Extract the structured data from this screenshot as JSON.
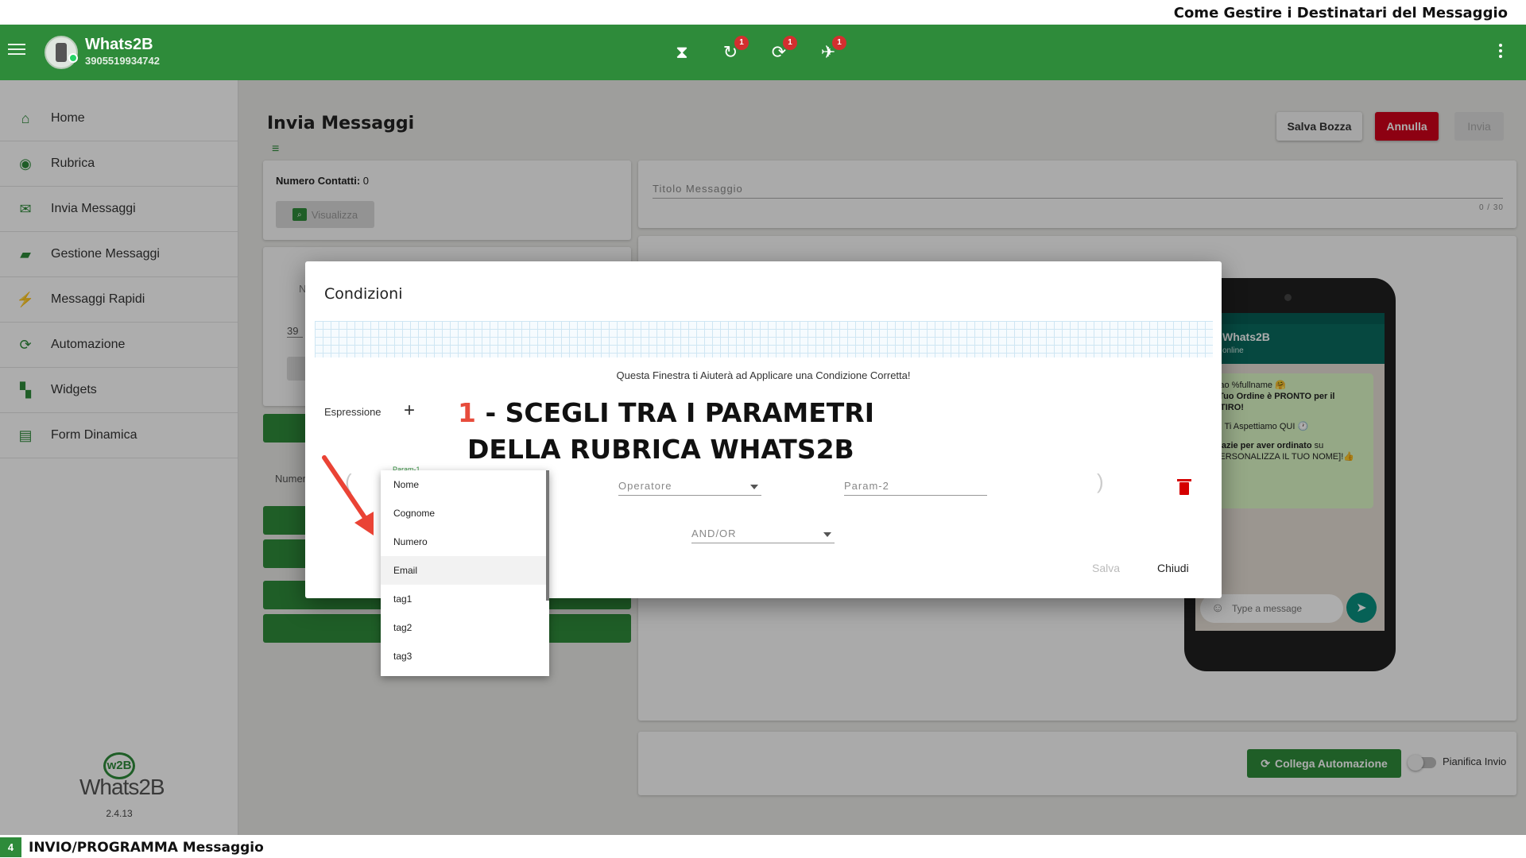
{
  "caption": {
    "title": "Come Gestire i Destinatari del Messaggio"
  },
  "header": {
    "app_name": "Whats2B",
    "phone_number": "3905519934742",
    "badges": [
      "1",
      "1",
      "1"
    ]
  },
  "sidebar": {
    "items": [
      {
        "label": "Home",
        "icon": "home-icon"
      },
      {
        "label": "Rubrica",
        "icon": "contacts-icon"
      },
      {
        "label": "Invia Messaggi",
        "icon": "mail-icon"
      },
      {
        "label": "Gestione Messaggi",
        "icon": "folder-icon"
      },
      {
        "label": "Messaggi Rapidi",
        "icon": "bolt-icon"
      },
      {
        "label": "Automazione",
        "icon": "sync-icon"
      },
      {
        "label": "Widgets",
        "icon": "widgets-icon"
      },
      {
        "label": "Form Dinamica",
        "icon": "form-icon"
      }
    ],
    "logo_mark": "w2B",
    "logo_text": "Whats2B",
    "version": "2.4.13"
  },
  "main": {
    "title": "Invia Messaggi",
    "save_draft": "Salva Bozza",
    "cancel": "Annulla",
    "send": "Invia",
    "contacts_label": "Numero Contatti:",
    "contacts_value": "0",
    "view_button": "Visualizza",
    "title_placeholder": "Titolo Messaggio",
    "title_counter": "0 / 30",
    "partial_field": "N",
    "partial_value": "39",
    "partial_num": "Numer",
    "automation_button": "Collega Automazione",
    "schedule_label": "Pianifica Invio"
  },
  "phone": {
    "chat_name": "Whats2B",
    "chat_status": "online",
    "bubble_line1": "Ciao %fullname 🤗",
    "bubble_line2": "Il Tuo Ordine è PRONTO per il RITIRO!",
    "bubble_line3": "🫴 Ti Aspettiamo QUI 🕐",
    "bubble_line4_bold": "Grazie per aver ordinato",
    "bubble_line4_rest": " su [PERSONALIZZA IL TUO NOME]!👍",
    "input_placeholder": "Type a message"
  },
  "dialog": {
    "title": "Condizioni",
    "hint": "Questa Finestra ti Aiuterà ad Applicare una Condizione Corretta!",
    "expression_label": "Espressione",
    "annotation_num": "1",
    "annotation_line1": " - SCEGLI TRA I PARAMETRI",
    "annotation_line2": "DELLA RUBRICA WHATS2B",
    "param1_label": "Param-1",
    "operator_placeholder": "Operatore",
    "param2_placeholder": "Param-2",
    "andor_placeholder": "AND/OR",
    "save": "Salva",
    "close": "Chiudi",
    "paren_open": "(",
    "paren_close": ")"
  },
  "dropdown": {
    "options": [
      "Nome",
      "Cognome",
      "Numero",
      "Email",
      "tag1",
      "tag2",
      "tag3"
    ],
    "highlighted": "Email"
  },
  "footer": {
    "page": "4",
    "title": "INVIO/PROGRAMMA Messaggio"
  },
  "colors": {
    "brand_green": "#2e8b3a",
    "danger_red": "#d0021b",
    "annotation_red": "#e74c3c"
  }
}
